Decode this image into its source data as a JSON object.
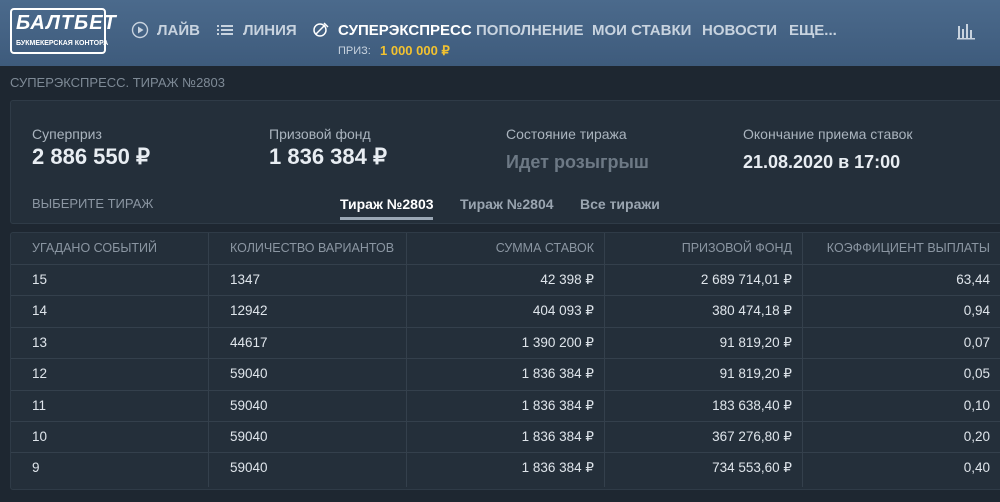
{
  "logo": {
    "line1": "БАЛТБЕТ",
    "line2": "Букмекерская контора"
  },
  "nav": [
    {
      "label": "ЛАЙВ",
      "icon": "play-icon"
    },
    {
      "label": "ЛИНИЯ",
      "icon": "list-icon"
    },
    {
      "label": "СУПЕРЭКСПРЕСС",
      "icon": "ball-icon"
    },
    {
      "label": "ПОПОЛНЕНИЕ"
    },
    {
      "label": "МОИ СТАВКИ"
    },
    {
      "label": "НОВОСТИ"
    },
    {
      "label": "ЕЩЕ..."
    }
  ],
  "prize": {
    "label": "ПРИЗ:",
    "value": "1 000 000 ₽"
  },
  "breadcrumb": "СУПЕРЭКСПРЕСС. ТИРАЖ №2803",
  "summary": {
    "superprize_label": "Суперприз",
    "superprize_value": "2 886 550 ₽",
    "fund_label": "Призовой фонд",
    "fund_value": "1 836 384 ₽",
    "state_label": "Состояние тиража",
    "state_value": "Идет розыгрыш",
    "end_label": "Окончание приема ставок",
    "end_value": "21.08.2020 в 17:00"
  },
  "tabs": {
    "choose_label": "ВЫБЕРИТЕ ТИРАЖ",
    "items": [
      "Тираж №2803",
      "Тираж №2804",
      "Все тиражи"
    ]
  },
  "table": {
    "headers": [
      "УГАДАНО СОБЫТИЙ",
      "КОЛИЧЕСТВО ВАРИАНТОВ",
      "СУММА СТАВОК",
      "ПРИЗОВОЙ ФОНД",
      "КОЭФФИЦИЕНТ ВЫПЛАТЫ"
    ],
    "rows": [
      [
        "15",
        "1347",
        "42 398 ₽",
        "2 689 714,01 ₽",
        "63,44"
      ],
      [
        "14",
        "12942",
        "404 093 ₽",
        "380 474,18 ₽",
        "0,94"
      ],
      [
        "13",
        "44617",
        "1 390 200 ₽",
        "91 819,20 ₽",
        "0,07"
      ],
      [
        "12",
        "59040",
        "1 836 384 ₽",
        "91 819,20 ₽",
        "0,05"
      ],
      [
        "11",
        "59040",
        "1 836 384 ₽",
        "183 638,40 ₽",
        "0,10"
      ],
      [
        "10",
        "59040",
        "1 836 384 ₽",
        "367 276,80 ₽",
        "0,20"
      ],
      [
        "9",
        "59040",
        "1 836 384 ₽",
        "734 553,60 ₽",
        "0,40"
      ]
    ]
  },
  "colors": {
    "topbar": "#45637f",
    "background": "#1e2731",
    "prize_accent": "#f2c230"
  }
}
